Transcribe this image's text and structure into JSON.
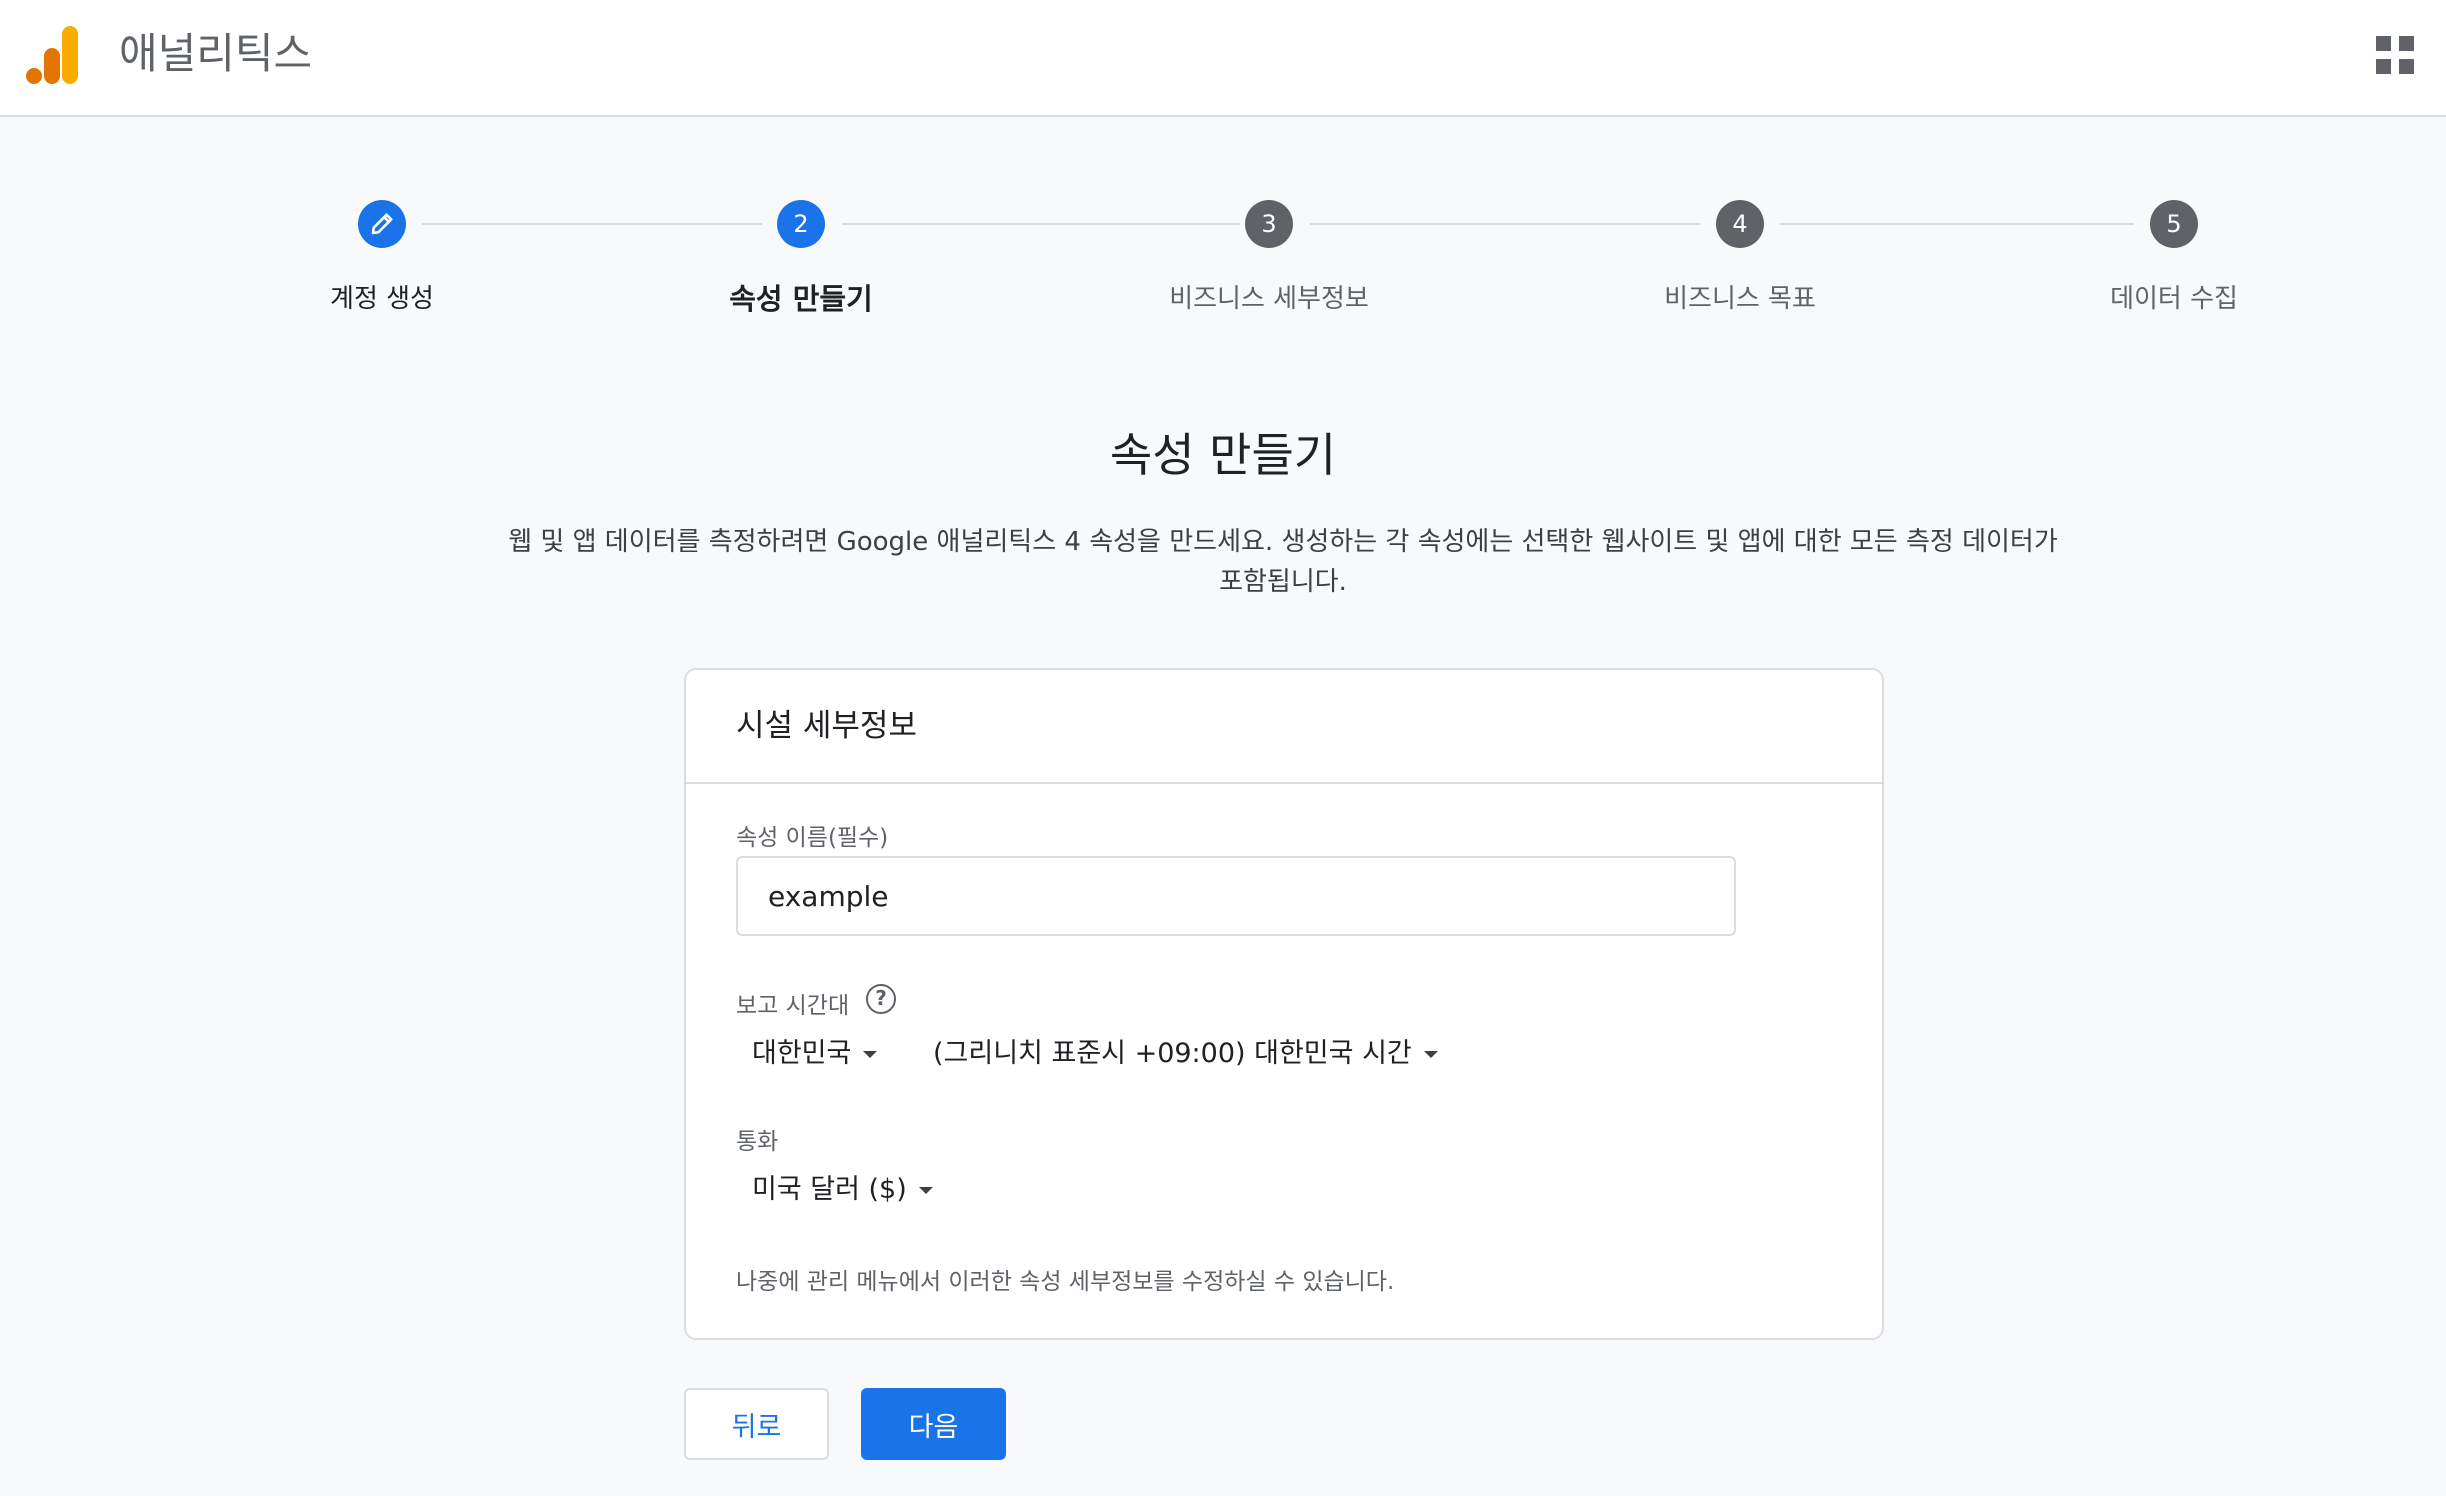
{
  "header": {
    "app_title": "애널리틱스",
    "logo_icon": "analytics-logo-icon",
    "apps_icon": "apps-grid-icon"
  },
  "stepper": {
    "steps": [
      {
        "number": "",
        "label": "계정 생성",
        "state": "done",
        "icon": "pencil-icon"
      },
      {
        "number": "2",
        "label": "속성 만들기",
        "state": "active"
      },
      {
        "number": "3",
        "label": "비즈니스 세부정보",
        "state": "upcoming"
      },
      {
        "number": "4",
        "label": "비즈니스 목표",
        "state": "upcoming"
      },
      {
        "number": "5",
        "label": "데이터 수집",
        "state": "upcoming"
      }
    ]
  },
  "main": {
    "title": "속성 만들기",
    "description_line1": "웹 및 앱 데이터를 측정하려면 Google 애널리틱스 4 속성을 만드세요. 생성하는 각 속성에는 선택한 웹사이트 및 앱에 대한 모든 측정 데이터가",
    "description_line2": "포함됩니다."
  },
  "card": {
    "header": "시설 세부정보",
    "property_name_label": "속성 이름(필수)",
    "property_name_value": "example",
    "timezone_label": "보고 시간대",
    "help_icon": "help-icon",
    "country_value": "대한민국",
    "timezone_value": "(그리니치 표준시 +09:00) 대한민국 시간",
    "currency_label": "통화",
    "currency_value": "미국 달러 ($)",
    "footnote": "나중에 관리 메뉴에서 이러한 속성 세부정보를 수정하실 수 있습니다."
  },
  "buttons": {
    "back_label": "뒤로",
    "next_label": "다음"
  },
  "colors": {
    "accent": "#1a73e8",
    "logo_orange": "#e37400",
    "logo_yellow": "#f9ab00",
    "inactive_step": "#5f6368"
  }
}
